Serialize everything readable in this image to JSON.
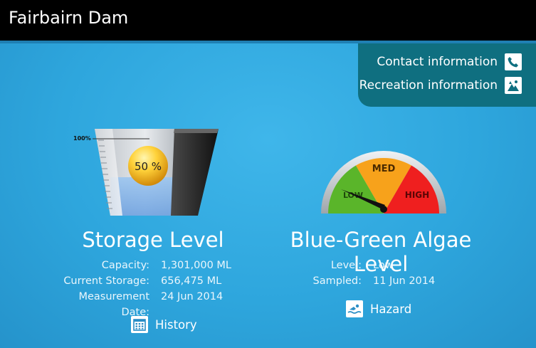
{
  "header": {
    "title": "Fairbairn Dam"
  },
  "info_panel": {
    "contact_label": "Contact information",
    "recreation_label": "Recreation information"
  },
  "storage": {
    "title": "Storage Level",
    "bucket_top_label": "100%",
    "percent_label": "50 %",
    "fill_fraction": 0.5,
    "rows": [
      {
        "key": "Capacity:",
        "value": "1,301,000 ML"
      },
      {
        "key": "Current Storage:",
        "value": "656,475 ML"
      },
      {
        "key": "Measurement Date:",
        "value": "24 Jun 2014"
      }
    ],
    "history_label": "History"
  },
  "algae": {
    "title": "Blue-Green Algae Level",
    "gauge_labels": {
      "low": "LOW",
      "med": "MED",
      "high": "HIGH"
    },
    "gauge_colors": {
      "low": "#5ab52a",
      "med": "#f7a21b",
      "high": "#ef1f1f"
    },
    "rows": [
      {
        "key": "Level:",
        "value": "Low"
      },
      {
        "key": "Sampled:",
        "value": "11 Jun 2014"
      }
    ],
    "hazard_label": "Hazard"
  }
}
